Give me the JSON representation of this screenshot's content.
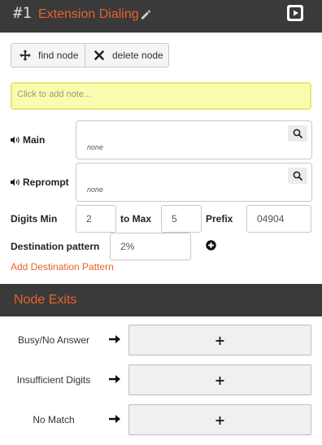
{
  "header": {
    "node_number": "#1",
    "title": "Extension Dialing"
  },
  "toolbar": {
    "find_label": "find node",
    "delete_label": "delete node"
  },
  "note": {
    "placeholder": "Click to add note..."
  },
  "prompts": {
    "main": {
      "label": "Main",
      "value": "none"
    },
    "reprompt": {
      "label": "Reprompt",
      "value": "none"
    }
  },
  "digits": {
    "min_label": "Digits Min",
    "min_value": "2",
    "max_label": "to Max",
    "max_value": "5",
    "prefix_label": "Prefix",
    "prefix_value": "04904"
  },
  "destination": {
    "label": "Destination pattern",
    "value": "2%",
    "add_link": "Add Destination Pattern"
  },
  "exits": {
    "title": "Node Exits",
    "items": [
      {
        "label": "Busy/No Answer"
      },
      {
        "label": "Insufficient Digits"
      },
      {
        "label": "No Match"
      }
    ],
    "add_symbol": "+"
  },
  "colors": {
    "accent": "#e8622c",
    "header_bg": "#3a3a3a",
    "note_bg": "#fbfbb0"
  },
  "icons": [
    "pencil-icon",
    "play-icon",
    "move-icon",
    "close-icon",
    "speaker-icon",
    "search-icon",
    "plus-circle-icon",
    "arrow-right-icon"
  ]
}
